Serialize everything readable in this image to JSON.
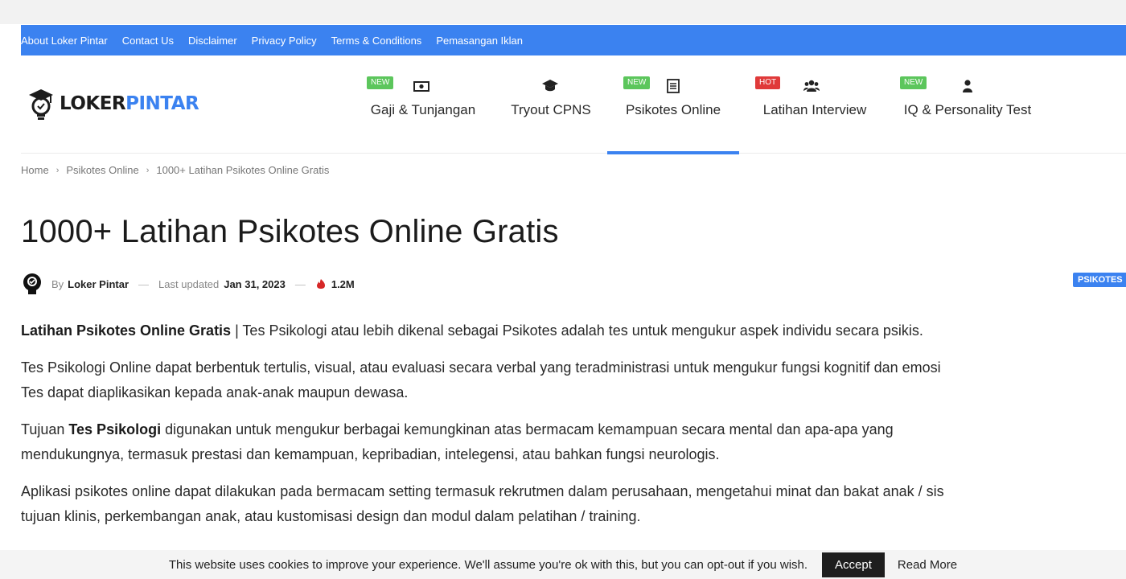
{
  "topbar": {
    "links": [
      "About Loker Pintar",
      "Contact Us",
      "Disclaimer",
      "Privacy Policy",
      "Terms & Conditions",
      "Pemasangan Iklan"
    ],
    "color": "#3b82f0"
  },
  "logo": {
    "part1": "LOKER",
    "part2": "PINTAR",
    "icon": "graduate-lightbulb-icon"
  },
  "nav": [
    {
      "label": "Gaji & Tunjangan",
      "badge": "NEW",
      "icon": "money-icon"
    },
    {
      "label": "Tryout CPNS",
      "badge": "",
      "icon": "graduation-cap-icon"
    },
    {
      "label": "Psikotes Online",
      "badge": "NEW",
      "icon": "list-icon",
      "active": true
    },
    {
      "label": "Latihan Interview",
      "badge": "HOT",
      "icon": "users-icon"
    },
    {
      "label": "IQ & Personality Test",
      "badge": "NEW",
      "icon": "user-icon"
    }
  ],
  "breadcrumb": [
    "Home",
    "Psikotes Online",
    "1000+ Latihan Psikotes Online Gratis"
  ],
  "article": {
    "title": "1000+ Latihan Psikotes Online Gratis",
    "by": "By",
    "author": "Loker Pintar",
    "updated_label": "Last updated",
    "updated_date": "Jan 31, 2023",
    "views": "1.2M",
    "category": "PSIKOTES",
    "p1_bold": "Latihan Psikotes Online Gratis",
    "p1_rest": " | Tes Psikologi atau lebih dikenal sebagai Psikotes adalah tes untuk mengukur aspek individu secara psikis.",
    "p2_line1": "Tes Psikologi Online dapat berbentuk tertulis, visual, atau evaluasi secara verbal yang teradministrasi untuk mengukur fungsi kognitif dan emosi",
    "p2_line2": "Tes dapat diaplikasikan kepada anak-anak maupun dewasa.",
    "p3_pre": "Tujuan ",
    "p3_bold": "Tes Psikologi",
    "p3_line1_rest": " digunakan untuk mengukur berbagai kemungkinan atas bermacam kemampuan secara mental dan apa-apa yang",
    "p3_line2": "mendukungnya, termasuk prestasi dan kemampuan, kepribadian, intelegensi, atau bahkan fungsi neurologis.",
    "p4_line1": "Aplikasi psikotes online dapat dilakukan pada bermacam setting termasuk rekrutmen dalam perusahaan, mengetahui minat dan bakat anak / sis",
    "p4_line2": "tujuan klinis, perkembangan anak, atau kustomisasi design dan modul dalam pelatihan / training."
  },
  "cookie": {
    "text": "This website uses cookies to improve your experience. We'll assume you're ok with this, but you can opt-out if you wish.",
    "accept": "Accept",
    "read_more": "Read More"
  }
}
